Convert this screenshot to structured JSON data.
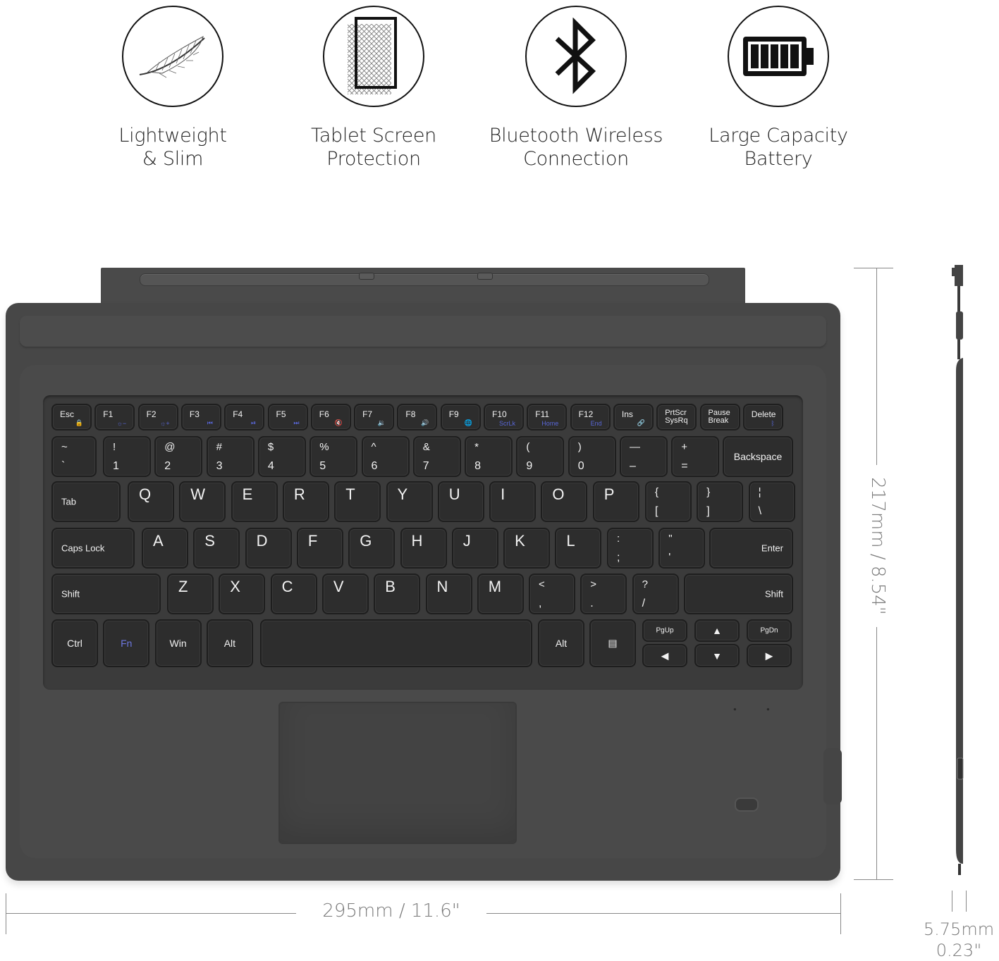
{
  "features": [
    {
      "icon": "feather-icon",
      "line1": "Lightweight",
      "line2": "& Slim"
    },
    {
      "icon": "screen-protection-icon",
      "line1": "Tablet Screen",
      "line2": "Protection"
    },
    {
      "icon": "bluetooth-icon",
      "line1": "Bluetooth Wireless",
      "line2": "Connection"
    },
    {
      "icon": "battery-icon",
      "line1": "Large Capacity",
      "line2": "Battery"
    }
  ],
  "keyboard": {
    "function_row": [
      {
        "label": "Esc",
        "sub": "🔒"
      },
      {
        "label": "F1",
        "sub": "☼−"
      },
      {
        "label": "F2",
        "sub": "☼+"
      },
      {
        "label": "F3",
        "sub": "⏮"
      },
      {
        "label": "F4",
        "sub": "⏯"
      },
      {
        "label": "F5",
        "sub": "⏭"
      },
      {
        "label": "F6",
        "sub": "🔇"
      },
      {
        "label": "F7",
        "sub": "🔉"
      },
      {
        "label": "F8",
        "sub": "🔊"
      },
      {
        "label": "F9",
        "sub": "🌐"
      },
      {
        "label": "F10",
        "sub": "ScrLk"
      },
      {
        "label": "F11",
        "sub": "Home"
      },
      {
        "label": "F12",
        "sub": "End"
      },
      {
        "label": "Ins",
        "sub": "🔗"
      },
      {
        "label": "PrtScr SysRq",
        "sub": ""
      },
      {
        "label": "Pause Break",
        "sub": ""
      },
      {
        "label": "Delete",
        "sub": "ᛒ"
      }
    ],
    "number_row": [
      {
        "up": "~",
        "lo": "`"
      },
      {
        "up": "!",
        "lo": "1"
      },
      {
        "up": "@",
        "lo": "2"
      },
      {
        "up": "#",
        "lo": "3"
      },
      {
        "up": "$",
        "lo": "4"
      },
      {
        "up": "%",
        "lo": "5"
      },
      {
        "up": "^",
        "lo": "6"
      },
      {
        "up": "&",
        "lo": "7"
      },
      {
        "up": "*",
        "lo": "8"
      },
      {
        "up": "(",
        "lo": "9"
      },
      {
        "up": ")",
        "lo": "0"
      },
      {
        "up": "—",
        "lo": "–"
      },
      {
        "up": "+",
        "lo": "="
      }
    ],
    "backspace": "Backspace",
    "tab": "Tab",
    "qwerty_row": [
      "Q",
      "W",
      "E",
      "R",
      "T",
      "Y",
      "U",
      "I",
      "O",
      "P"
    ],
    "bracket_keys": [
      {
        "up": "{",
        "lo": "["
      },
      {
        "up": "}",
        "lo": "]"
      },
      {
        "up": "¦",
        "lo": "\\"
      }
    ],
    "caps_lock": "Caps Lock",
    "home_row": [
      "A",
      "S",
      "D",
      "F",
      "G",
      "H",
      "J",
      "K",
      "L"
    ],
    "home_punct": [
      {
        "up": ":",
        "lo": ";"
      },
      {
        "up": "\"",
        "lo": "'"
      }
    ],
    "enter": "Enter",
    "shift": "Shift",
    "bottom_letters": [
      "Z",
      "X",
      "C",
      "V",
      "B",
      "N",
      "M"
    ],
    "bottom_punct": [
      {
        "up": "<",
        "lo": ","
      },
      {
        "up": ">",
        "lo": "."
      },
      {
        "up": "?",
        "lo": "/"
      }
    ],
    "ctrl": "Ctrl",
    "fn": "Fn",
    "win": "Win",
    "alt": "Alt",
    "alt_right": "Alt",
    "pgup": "PgUp",
    "pgdn": "PgDn"
  },
  "dimensions": {
    "width": "295mm / 11.6\"",
    "depth": "217mm / 8.54\"",
    "thickness_mm": "5.75mm",
    "thickness_in": "0.23\""
  },
  "colors": {
    "body": "#474747",
    "key": "#2d2d2d",
    "fn_accent": "#5866d6"
  }
}
